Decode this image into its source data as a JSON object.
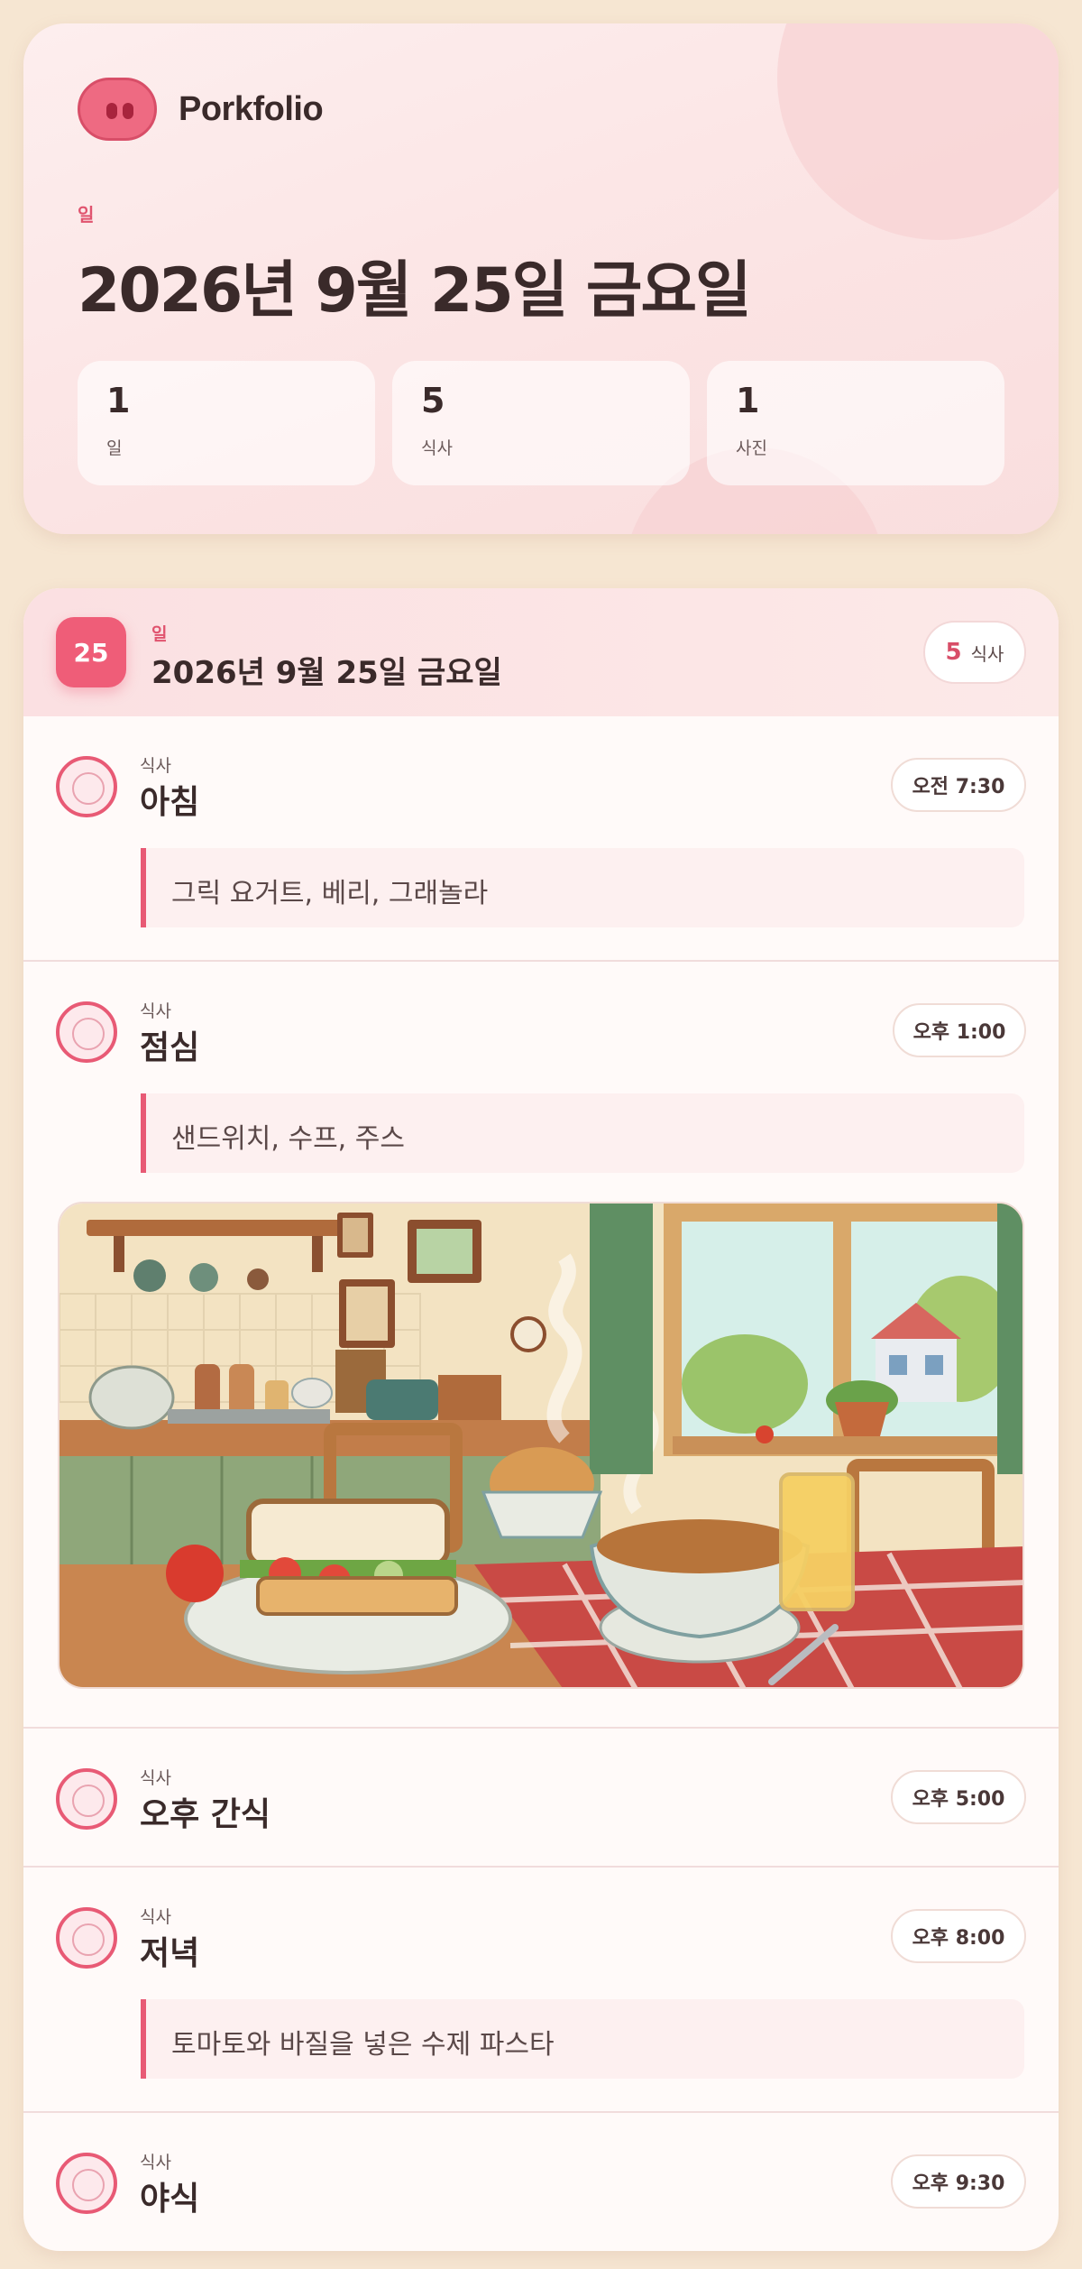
{
  "app": {
    "name": "Porkfolio"
  },
  "summary": {
    "label": "일",
    "title": "2026년 9월 25일 금요일",
    "stats": [
      {
        "value": "1",
        "label": "일"
      },
      {
        "value": "5",
        "label": "식사"
      },
      {
        "value": "1",
        "label": "사진"
      }
    ]
  },
  "day": {
    "badge": "25",
    "label": "일",
    "title": "2026년 9월 25일 금요일",
    "meal_count": "5",
    "meal_count_label": "식사"
  },
  "meals": [
    {
      "category": "식사",
      "name": "아침",
      "time": "오전 7:30",
      "note": "그릭 요거트, 베리, 그래놀라"
    },
    {
      "category": "식사",
      "name": "점심",
      "time": "오후 1:00",
      "note": "샌드위치, 수프, 주스"
    },
    {
      "category": "식사",
      "name": "오후 간식",
      "time": "오후 5:00"
    },
    {
      "category": "식사",
      "name": "저녁",
      "time": "오후 8:00",
      "note": "토마토와 바질을 넣은 수제 파스타"
    },
    {
      "category": "식사",
      "name": "야식",
      "time": "오후 9:30"
    }
  ],
  "icons": {
    "logo": "pig-snout-icon",
    "meal": "plate-icon"
  },
  "colors": {
    "accent": "#ef5d78",
    "background": "#f6e6d2",
    "card": "#fffaf9"
  }
}
